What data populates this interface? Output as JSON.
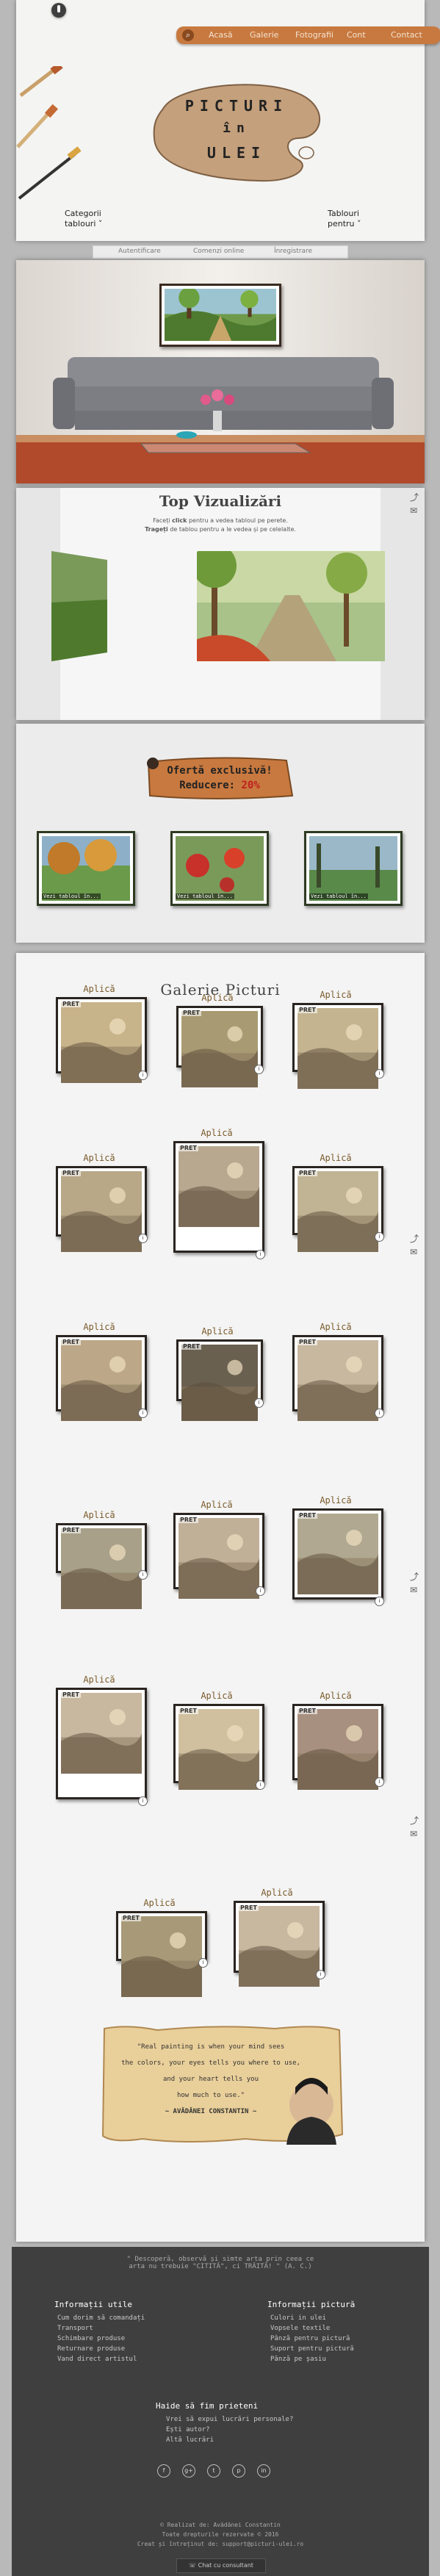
{
  "header": {
    "nav": [
      "Acasă",
      "Galerie",
      "Fotografii",
      "Cont",
      "Contact"
    ],
    "brand": [
      "PICTURI",
      "în",
      "ULEI"
    ],
    "left_menu": [
      "Categorii",
      "tablouri"
    ],
    "right_menu": [
      "Tablouri",
      "pentru"
    ],
    "subnav": [
      "Autentificare",
      "Comenzi online",
      "Înregistrare"
    ]
  },
  "top_views": {
    "title": "Top Vizualizări",
    "line1_pre": "Faceți ",
    "line1_bold": "click",
    "line1_post": " pentru a vedea tabloul pe perete.",
    "line2_bold": "Trageți",
    "line2_post": " de tablou pentru a le vedea și pe celelalte."
  },
  "offer": {
    "title": "Ofertă exclusivă!",
    "discount_label": "Reducere:",
    "discount_value": "20%",
    "card_label": "Vezi tabloul în..."
  },
  "gallery": {
    "title": "Galerie Picturi",
    "apply_label": "Aplică",
    "price_label": "PRET",
    "info": "i"
  },
  "quote": {
    "lines": [
      "\"Real painting is when your mind sees",
      "the colors, your eyes tells you where to use,",
      "and your heart tells you",
      "how much to use.\""
    ],
    "author": "~ AVĂDĂNEI CONSTANTIN ~"
  },
  "footer": {
    "motto": [
      "\" Descoperă, observă și simte arta prin ceea ce",
      "arta nu trebuie \"CITITĂ\", ci TRĂITĂ! \" (A. C.)"
    ],
    "col1_title": "Informații utile",
    "col1_items": [
      "Cum dorim să comandați",
      "Transport",
      "Schimbare produse",
      "Returnare produse",
      "Vand direct artistul"
    ],
    "col2_title": "Informații pictură",
    "col2_items": [
      "Culori in ulei",
      "Vopsele textile",
      "Pânză pentru pictură",
      "Suport pentru pictură",
      "Pânză pe șasiu"
    ],
    "friends_title": "Haide să fim prieteni",
    "friends_items": [
      "Vrei să expui lucrări personale?",
      "Ești autor?",
      "Altă lucrări"
    ],
    "social": [
      "f",
      "g+",
      "t",
      "p",
      "in"
    ],
    "copy": [
      "© Realizat de: Avădănei Constantin",
      "Toate drepturile rezervate © 2016",
      "Creat și întreținut de: support@picturi-ulei.ro"
    ],
    "chat": "Chat cu consultant"
  },
  "colors": {
    "accent": "#c8793f",
    "dark": "#3f3f3f",
    "wall": "#f2f2f2"
  }
}
